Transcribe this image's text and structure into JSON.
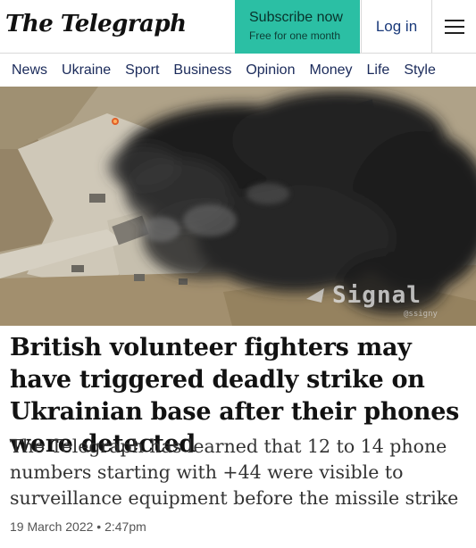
{
  "header": {
    "logo_text": "The Telegraph",
    "subscribe_label": "Subscribe now",
    "subscribe_sublabel": "Free for one month",
    "login_label": "Log in",
    "menu_icon": "hamburger-menu-icon",
    "accent_color": "#2bbfa4"
  },
  "nav": {
    "items": [
      "News",
      "Ukraine",
      "Sport",
      "Business",
      "Opinion",
      "Money",
      "Life",
      "Style"
    ]
  },
  "image": {
    "watermark_text": "Signal",
    "watermark_handle": "@ssigny"
  },
  "article": {
    "headline": "British volunteer fighters may have triggered deadly strike on Ukrainian base after their phones were detected",
    "standfirst": "The Telegraph has learned that 12 to 14 phone numbers starting with +44 were visible to surveillance equipment before the missile strike",
    "date": "19 March 2022 • 2:47pm"
  }
}
